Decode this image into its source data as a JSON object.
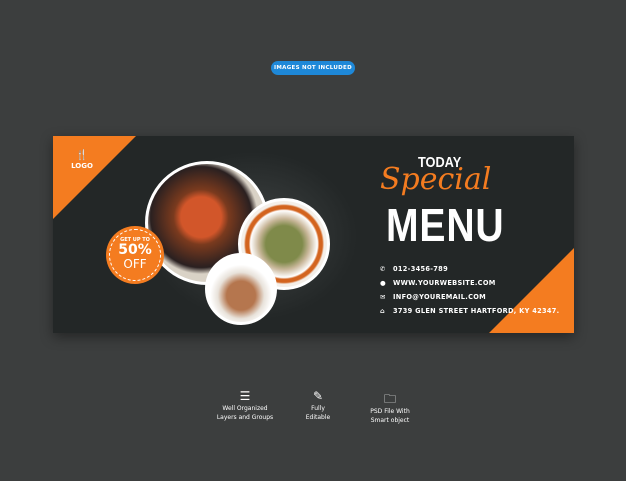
{
  "pill": "IMAGES NOT INCLUDED",
  "banner": {
    "logo": "LOGO",
    "logo_icon": "fork-knife-icon",
    "badge": {
      "top": "GET UP TO",
      "amount": "50%",
      "bottom": "OFF"
    },
    "today": "TODAY",
    "special": "Special",
    "menu": "MENU",
    "contacts": [
      {
        "icon": "phone-icon",
        "text": "012-3456-789"
      },
      {
        "icon": "globe-icon",
        "text": "WWW.YOURWEBSITE.COM"
      },
      {
        "icon": "mail-icon",
        "text": "INFO@YOUREMAIL.COM"
      },
      {
        "icon": "home-icon",
        "text": "3739 GLEN STREET HARTFORD, KY 42347."
      }
    ]
  },
  "features": [
    {
      "icon": "layers-icon",
      "line1": "Well Organized",
      "line2": "Layers and Groups"
    },
    {
      "icon": "edit-icon",
      "line1": "Fully",
      "line2": "Editable"
    },
    {
      "icon": "folder-icon",
      "line1": "PSD File With",
      "line2": "Smart object"
    }
  ],
  "colors": {
    "accent": "#f47c20",
    "banner": "#232727",
    "background": "#3c3e3e",
    "pill": "#1e88d8"
  }
}
